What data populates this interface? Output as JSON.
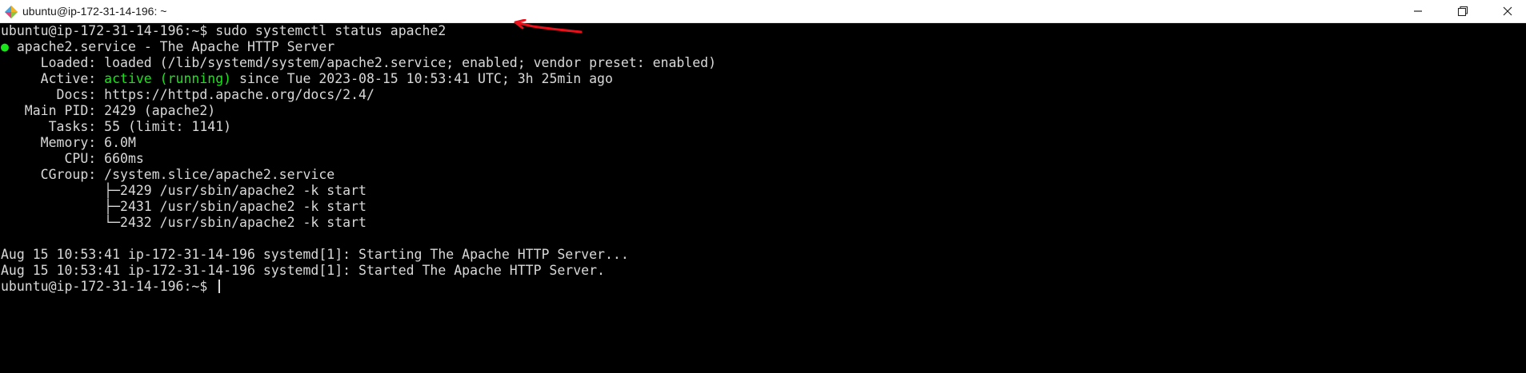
{
  "window": {
    "title": "ubuntu@ip-172-31-14-196: ~",
    "icon": "putty-icon"
  },
  "terminal": {
    "prompt_cmd": "ubuntu@ip-172-31-14-196:~$ sudo systemctl status apache2",
    "status_dot": "●",
    "service_header": " apache2.service - The Apache HTTP Server",
    "loaded": "     Loaded: loaded (/lib/systemd/system/apache2.service; enabled; vendor preset: enabled)",
    "active_label": "     Active: ",
    "active_state": "active (running)",
    "active_since": " since Tue 2023-08-15 10:53:41 UTC; 3h 25min ago",
    "docs": "       Docs: https://httpd.apache.org/docs/2.4/",
    "main_pid": "   Main PID: 2429 (apache2)",
    "tasks": "      Tasks: 55 (limit: 1141)",
    "memory": "     Memory: 6.0M",
    "cpu": "        CPU: 660ms",
    "cgroup": "     CGroup: /system.slice/apache2.service",
    "proc1": "             ├─2429 /usr/sbin/apache2 -k start",
    "proc2": "             ├─2431 /usr/sbin/apache2 -k start",
    "proc3": "             └─2432 /usr/sbin/apache2 -k start",
    "log1": "Aug 15 10:53:41 ip-172-31-14-196 systemd[1]: Starting The Apache HTTP Server...",
    "log2": "Aug 15 10:53:41 ip-172-31-14-196 systemd[1]: Started The Apache HTTP Server.",
    "prompt_final": "ubuntu@ip-172-31-14-196:~$ "
  },
  "colors": {
    "background": "#000000",
    "text": "#d9d9d9",
    "active_green": "#19e619",
    "annotation_red": "#e8101a"
  }
}
